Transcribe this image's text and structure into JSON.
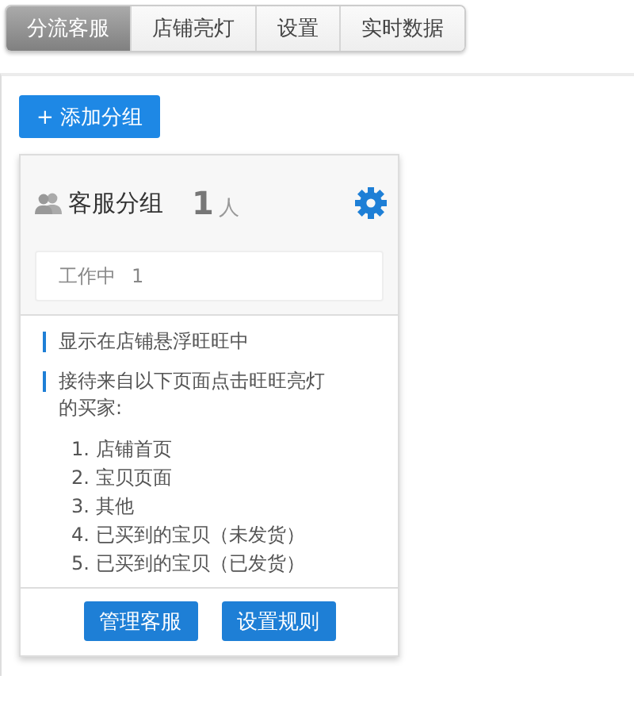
{
  "tabs": [
    {
      "label": "分流客服",
      "selected": true
    },
    {
      "label": "店铺亮灯",
      "selected": false
    },
    {
      "label": "设置",
      "selected": false
    },
    {
      "label": "实时数据",
      "selected": false
    }
  ],
  "add_button": "+ 添加分组",
  "group": {
    "title": "客服分组",
    "count": "1",
    "count_unit": "人",
    "status": {
      "label": "工作中",
      "value": "1"
    },
    "notes": [
      "显示在店铺悬浮旺旺中",
      "接待来自以下页面点击旺旺亮灯的买家:"
    ],
    "pages": [
      "1. 店铺首页",
      "2. 宝贝页面",
      "3. 其他",
      "4. 已买到的宝贝（未发货）",
      "5. 已买到的宝贝（已发货）"
    ],
    "buttons": [
      "管理客服",
      "设置规则"
    ]
  }
}
